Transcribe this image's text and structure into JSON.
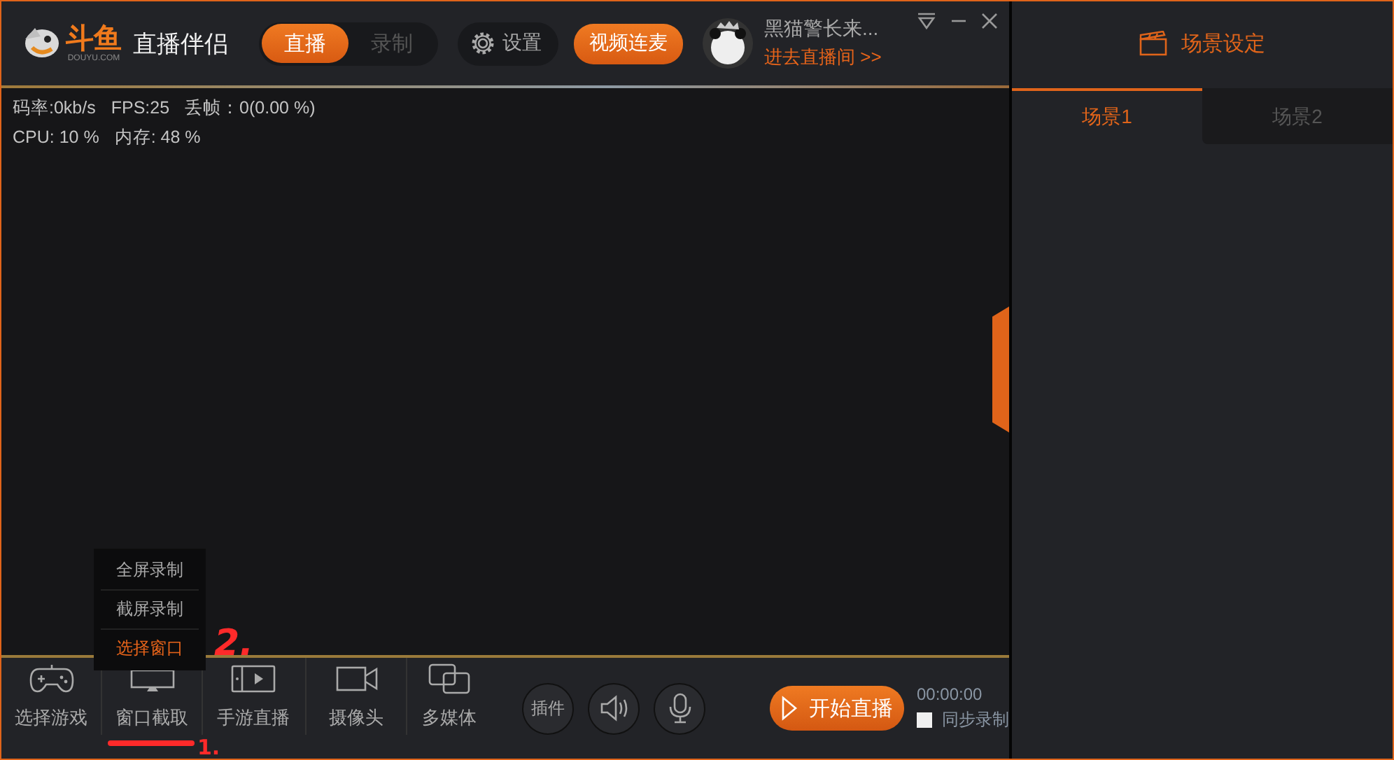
{
  "logo": {
    "brand": "斗鱼",
    "domain": "DOUYU.COM",
    "app_name": "直播伴侣"
  },
  "mode_tabs": [
    {
      "label": "直播",
      "selected": true
    },
    {
      "label": "录制",
      "selected": false
    }
  ],
  "settings_button": {
    "label": "设置"
  },
  "video_link_button": {
    "label": "视频连麦"
  },
  "user": {
    "name": "黑猫警长来...",
    "link": "进去直播间 >>"
  },
  "stats": [
    [
      "码率:0kb/s",
      "FPS:25",
      "丢帧：0(0.00 %)"
    ],
    [
      "CPU: 10 %",
      "内存: 48 %"
    ]
  ],
  "source_menu": [
    {
      "label": "全屏录制",
      "selected": false
    },
    {
      "label": "截屏录制",
      "selected": false
    },
    {
      "label": "选择窗口",
      "selected": true
    }
  ],
  "toolbar": [
    {
      "kind": "gamepad",
      "label": "选择游戏"
    },
    {
      "kind": "monitor",
      "label": "窗口截取"
    },
    {
      "kind": "phone",
      "label": "手游直播"
    },
    {
      "kind": "camera",
      "label": "摄像头"
    },
    {
      "kind": "media",
      "label": "多媒体"
    }
  ],
  "circle_buttons": [
    {
      "kind": "text",
      "label": "插件"
    },
    {
      "kind": "speaker"
    },
    {
      "kind": "mic"
    }
  ],
  "start_button": {
    "label": "开始直播"
  },
  "timer": "00:00:00",
  "sync_record": {
    "label": "同步录制",
    "checked": false
  },
  "scene_panel": {
    "title": "场景设定",
    "tabs": [
      {
        "label": "场景1",
        "selected": true
      },
      {
        "label": "场景2",
        "selected": false
      }
    ]
  },
  "annotations": [
    {
      "text": "2."
    },
    {
      "text": "1."
    }
  ]
}
